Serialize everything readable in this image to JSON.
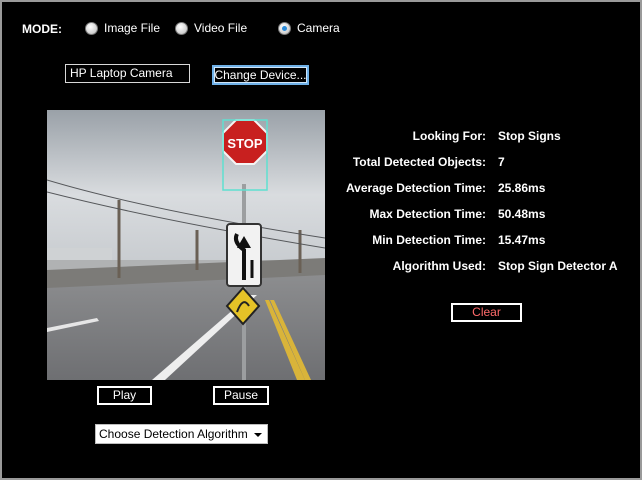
{
  "mode": {
    "label": "MODE:",
    "options": [
      {
        "label": "Image File",
        "checked": false
      },
      {
        "label": "Video File",
        "checked": false
      },
      {
        "label": "Camera",
        "checked": true
      }
    ]
  },
  "device": {
    "value": "HP Laptop Camera",
    "change_label": "Change Device..."
  },
  "video": {
    "sign_text": "STOP",
    "detection_color": "#5fe0d0"
  },
  "controls": {
    "play_label": "Play",
    "pause_label": "Pause"
  },
  "algorithm_select": {
    "selected": "Choose Detection Algorithm"
  },
  "stats": [
    {
      "label": "Looking For:",
      "value": "Stop Signs"
    },
    {
      "label": "Total Detected Objects:",
      "value": "7"
    },
    {
      "label": "Average Detection Time:",
      "value": "25.86ms"
    },
    {
      "label": "Max Detection Time:",
      "value": "50.48ms"
    },
    {
      "label": "Min Detection Time:",
      "value": "15.47ms"
    },
    {
      "label": "Algorithm Used:",
      "value": "Stop Sign Detector A"
    }
  ],
  "clear_label": "Clear"
}
